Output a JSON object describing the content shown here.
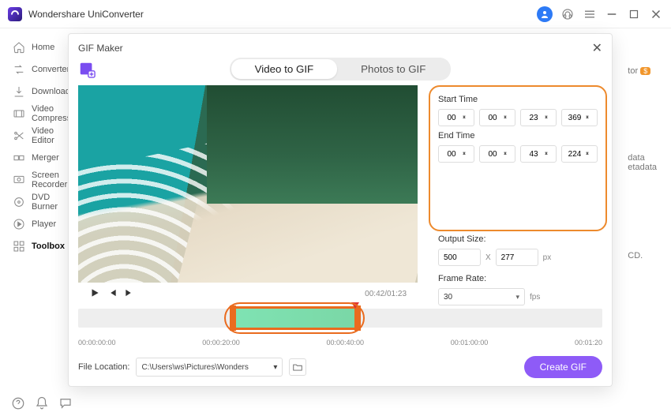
{
  "app": {
    "title": "Wondershare UniConverter"
  },
  "sidebar": {
    "items": [
      {
        "label": "Home"
      },
      {
        "label": "Converter"
      },
      {
        "label": "Downloader"
      },
      {
        "label": "Video Compressor"
      },
      {
        "label": "Video Editor"
      },
      {
        "label": "Merger"
      },
      {
        "label": "Screen Recorder"
      },
      {
        "label": "DVD Burner"
      },
      {
        "label": "Player"
      },
      {
        "label": "Toolbox"
      }
    ]
  },
  "bg": {
    "tor_label": "tor",
    "badge": "$",
    "data_label": "data",
    "etadata_label": "etadata",
    "cd_label": "CD."
  },
  "dialog": {
    "title": "GIF Maker",
    "tabs": {
      "video": "Video to GIF",
      "photo": "Photos to GIF"
    },
    "playback": {
      "time": "00:42/01:23"
    },
    "start_label": "Start Time",
    "end_label": "End Time",
    "start": {
      "h": "00",
      "m": "00",
      "s": "23",
      "ms": "369"
    },
    "end": {
      "h": "00",
      "m": "00",
      "s": "43",
      "ms": "224"
    },
    "output_size_label": "Output Size:",
    "output": {
      "w": "500",
      "x": "X",
      "h": "277",
      "unit": "px"
    },
    "frame_rate_label": "Frame Rate:",
    "frame_rate": {
      "value": "30",
      "unit": "fps"
    },
    "timeline": {
      "ticks": [
        "00:00:00:00",
        "00:00:20:00",
        "00:00:40:00",
        "00:01:00:00",
        "00:01:20"
      ]
    },
    "file_location_label": "File Location:",
    "file_location": "C:\\Users\\ws\\Pictures\\Wonders",
    "create_label": "Create GIF"
  }
}
